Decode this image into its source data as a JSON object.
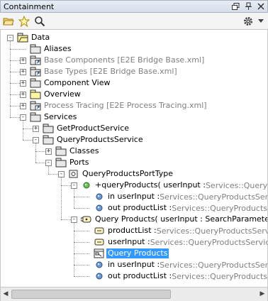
{
  "window": {
    "title": "Containment",
    "restore_icon": "restore-icon",
    "pin_icon": "pin-icon",
    "close_icon": "close-icon"
  },
  "toolbar": {
    "icons": [
      "open-folder-icon",
      "star-icon",
      "search-icon",
      "gear-icon",
      "dropdown-arrow-icon"
    ]
  },
  "tree": {
    "items": [
      {
        "label": "Data",
        "icon": "package-open-icon",
        "expander": "-"
      },
      {
        "label": "Aliases",
        "icon": "package-icon",
        "expander": ""
      },
      {
        "label": "Base Components [E2E Bridge Base.xml]",
        "icon": "package-link-icon",
        "expander": "+"
      },
      {
        "label": "Base Types [E2E Bridge Base.xml]",
        "icon": "package-link-icon",
        "expander": "+"
      },
      {
        "label": "Component View",
        "icon": "package-icon",
        "expander": "+"
      },
      {
        "label": "Overview",
        "icon": "folder-icon",
        "expander": "+"
      },
      {
        "label": "Process Tracing [E2E Process Tracing.xml]",
        "icon": "package-link-icon",
        "expander": "+"
      },
      {
        "label": "Services",
        "icon": "package-icon",
        "expander": "-"
      },
      {
        "label": "GetProductService",
        "icon": "package-icon",
        "expander": "+"
      },
      {
        "label": "QueryProductsService",
        "icon": "package-icon",
        "expander": "-"
      },
      {
        "label": "Classes",
        "icon": "package-icon",
        "expander": "+"
      },
      {
        "label": "Ports",
        "icon": "package-icon",
        "expander": "-"
      },
      {
        "label": "QueryProductsPortType",
        "icon": "port-type-icon",
        "expander": "-"
      },
      {
        "label": "+queryProducts( userInput : ",
        "tail": "Services::QueryProd",
        "icon": "operation-icon",
        "expander": "-"
      },
      {
        "label": "in userInput : ",
        "tail": "Services::QueryProductsServic",
        "icon": "parameter-icon",
        "expander": ""
      },
      {
        "label": "out productList : ",
        "tail": "Services::QueryProductsServ",
        "icon": "parameter-icon",
        "expander": ""
      },
      {
        "label": "Query Products( userInput : SearchParameters, pr",
        "icon": "activity-icon",
        "expander": "-"
      },
      {
        "label": "productList : ",
        "tail": "Services::QueryProductsService::",
        "icon": "pin-param-icon",
        "expander": ""
      },
      {
        "label": "userInput : ",
        "tail": "Services::QueryProductsService::Q",
        "icon": "pin-param-icon",
        "expander": ""
      },
      {
        "label": "Query Products",
        "icon": "diagram-icon",
        "expander": "",
        "selected": true
      },
      {
        "label": "in userInput : ",
        "tail": "Services::QueryProductsServic",
        "icon": "parameter-icon",
        "expander": ""
      },
      {
        "label": "out productList : ",
        "tail": "Services::QueryProductsServ",
        "icon": "parameter-icon",
        "expander": ""
      }
    ]
  },
  "scrollbar": {
    "left_arrow": "◀",
    "right_arrow": "▶"
  }
}
